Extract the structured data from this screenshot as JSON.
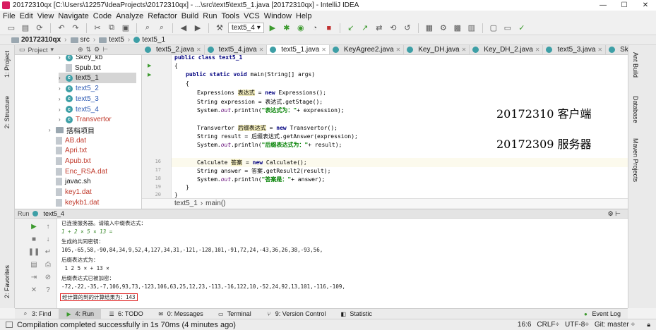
{
  "window": {
    "title": "20172310qx [C:\\Users\\12257\\IdeaProjects\\20172310qx] - ...\\src\\text5\\text5_1.java [20172310qx] - IntelliJ IDEA",
    "min": "—",
    "max": "☐",
    "close": "✕"
  },
  "menu": [
    "File",
    "Edit",
    "View",
    "Navigate",
    "Code",
    "Analyze",
    "Refactor",
    "Build",
    "Run",
    "Tools",
    "VCS",
    "Window",
    "Help"
  ],
  "toolbar": {
    "run_config": "text5_4"
  },
  "navbar": {
    "project": "20172310qx",
    "src": "src",
    "pkg": "text5",
    "cls": "text5_1"
  },
  "left_tools": {
    "project": "1: Project",
    "structure": "2: Structure",
    "favorites": "2: Favorites"
  },
  "right_tools": {
    "ant": "Ant Build",
    "database": "Database",
    "maven": "Maven Projects"
  },
  "project_panel": {
    "header": "Project",
    "items": [
      {
        "label": "Skey_kb",
        "kind": "class",
        "level": 2,
        "color": ""
      },
      {
        "label": "Spub.txt",
        "kind": "file",
        "level": 2,
        "color": ""
      },
      {
        "label": "text5_1",
        "kind": "class",
        "level": 2,
        "color": "",
        "selected": true
      },
      {
        "label": "text5_2",
        "kind": "class",
        "level": 2,
        "color": "blue"
      },
      {
        "label": "text5_3",
        "kind": "class",
        "level": 2,
        "color": "blue"
      },
      {
        "label": "text5_4",
        "kind": "class",
        "level": 2,
        "color": "blue"
      },
      {
        "label": "Transvertor",
        "kind": "class",
        "level": 2,
        "color": "red"
      },
      {
        "label": "搭档项目",
        "kind": "folder",
        "level": 1,
        "color": ""
      },
      {
        "label": "AB.dat",
        "kind": "file",
        "level": 1,
        "color": "red"
      },
      {
        "label": "Apri.txt",
        "kind": "file",
        "level": 1,
        "color": "red"
      },
      {
        "label": "Apub.txt",
        "kind": "file",
        "level": 1,
        "color": "red"
      },
      {
        "label": "Enc_RSA.dat",
        "kind": "file",
        "level": 1,
        "color": "red"
      },
      {
        "label": "javac.sh",
        "kind": "file",
        "level": 1,
        "color": ""
      },
      {
        "label": "key1.dat",
        "kind": "file",
        "level": 1,
        "color": "red"
      },
      {
        "label": "keykb1.dat",
        "kind": "file",
        "level": 1,
        "color": "red"
      }
    ]
  },
  "editor_tabs": [
    {
      "label": "text5_2.java",
      "active": false
    },
    {
      "label": "text5_4.java",
      "active": false
    },
    {
      "label": "text5_1.java",
      "active": true
    },
    {
      "label": "KeyAgree2.java",
      "active": false
    },
    {
      "label": "Key_DH.java",
      "active": false
    },
    {
      "label": "Key_DH_2.java",
      "active": false
    },
    {
      "label": "text5_3.java",
      "active": false
    },
    {
      "label": "Skey_kb.java",
      "active": false
    }
  ],
  "code": {
    "line_numbers": [
      "",
      "",
      "",
      "",
      "",
      "",
      "",
      "",
      "",
      "",
      "",
      "",
      "",
      "",
      "16",
      "17",
      "18",
      "19",
      "20",
      ""
    ],
    "l_class": "public class text5_1",
    "l_open": "{",
    "l_main_kw": "public static void",
    "l_main_rest": " main(String[] args)",
    "l_brace": "{",
    "l_expr_a": "Expressions ",
    "l_expr_hl": "表达式",
    "l_expr_b": " = ",
    "l_expr_new": "new",
    "l_expr_c": " Expressions();",
    "l_strexp_a": "String expression = 表达式.getStage();",
    "l_p1_a": "System.",
    "l_p1_out": "out",
    "l_p1_b": ".println(",
    "l_p1_str": "\"表达式为：\"",
    "l_p1_c": "+ expression);",
    "l_tr_a": "Transvertor ",
    "l_tr_hl": "后缀表达式",
    "l_tr_b": " = ",
    "l_tr_new": "new",
    "l_tr_c": " Transvertor();",
    "l_res_a": "String result = 后缀表达式.getAnswer(expression);",
    "l_p2_a": "System.",
    "l_p2_out": "out",
    "l_p2_b": ".println(",
    "l_p2_str": "\"后缀表达式为：\"",
    "l_p2_c": "+ result);",
    "l_ca_a": "Calculate ",
    "l_ca_hl": "答案",
    "l_ca_b": " = ",
    "l_ca_new": "new",
    "l_ca_c": " Calculate();",
    "l_ans_a": "String answer = 答案.getResult2(result);",
    "l_p3_a": "System.",
    "l_p3_out": "out",
    "l_p3_b": ".println(",
    "l_p3_str": "\"答案是：\"",
    "l_p3_c": "+ answer);",
    "l_close1": "}",
    "l_close2": "}"
  },
  "overlay": {
    "client": "20172310  客户端",
    "server": "20172309  服务器"
  },
  "editor_breadcrumb": {
    "cls": "text5_1",
    "method": "main()"
  },
  "run_panel": {
    "label": "Run",
    "config": "text5_4",
    "console": [
      {
        "text": "已连接服务器。请输入中缀表达式：",
        "input": false
      },
      {
        "text": "1 + 2 × 5 × 13 =",
        "input": true
      },
      {
        "text": "生成的共同密钥：",
        "input": false
      },
      {
        "text": "105,-65,58,-90,84,34,9,52,4,127,34,31,-121,-128,101,-91,72,24,-43,36,26,38,-93,56,",
        "input": false
      },
      {
        "text": "后缀表达式为：",
        "input": false
      },
      {
        "text": " 1 2 5 × + 13 ×",
        "input": false
      },
      {
        "text": "后缀表达式已被加密：",
        "input": false
      },
      {
        "text": "-72,-22,-35,-7,106,93,73,-123,106,63,25,12,23,-113,-16,122,10,-52,24,92,13,101,-116,-109,",
        "input": false
      }
    ],
    "result": "经计算的到的计算结果为：143"
  },
  "tool_windows": [
    {
      "icon": "search-icon",
      "label": "3: Find",
      "active": false
    },
    {
      "icon": "run-icon",
      "label": "4: Run",
      "active": true
    },
    {
      "icon": "todo-icon",
      "label": "6: TODO",
      "active": false
    },
    {
      "icon": "messages-icon",
      "label": "0: Messages",
      "active": false
    },
    {
      "icon": "terminal-icon",
      "label": "Terminal",
      "active": false
    },
    {
      "icon": "vcs-icon",
      "label": "9: Version Control",
      "active": false
    },
    {
      "icon": "statistic-icon",
      "label": "Statistic",
      "active": false
    }
  ],
  "event_log": "Event Log",
  "status": {
    "message": "Compilation completed successfully in 1s 70ms (4 minutes ago)",
    "position": "16:6",
    "line_sep": "CRLF÷",
    "encoding": "UTF-8÷",
    "git": "Git: master ÷"
  }
}
